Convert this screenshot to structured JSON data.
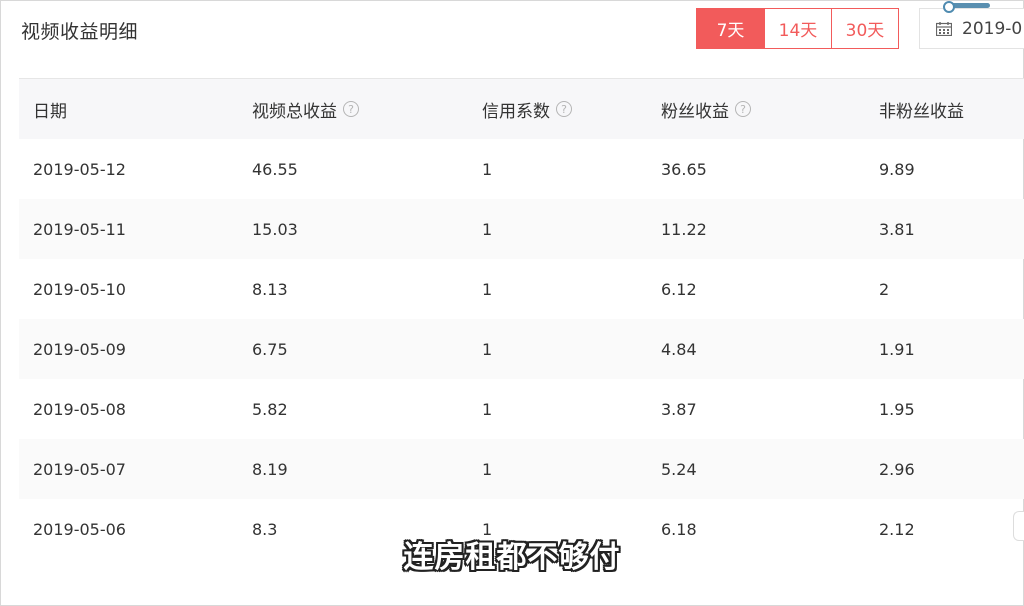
{
  "page": {
    "title": "视频收益明细"
  },
  "range_buttons": [
    {
      "label": "7天",
      "active": true
    },
    {
      "label": "14天",
      "active": false
    },
    {
      "label": "30天",
      "active": false
    }
  ],
  "date_picker": {
    "value": "2019-0",
    "icon": "calendar-icon"
  },
  "colors": {
    "accent": "#f25b5b",
    "header_bg": "#f7f7f9"
  },
  "table": {
    "headers": [
      "日期",
      "视频总收益",
      "信用系数",
      "粉丝收益",
      "非粉丝收益"
    ],
    "help_icon_on": [
      1,
      2,
      3
    ],
    "rows": [
      [
        "2019-05-12",
        "46.55",
        "1",
        "36.65",
        "9.89"
      ],
      [
        "2019-05-11",
        "15.03",
        "1",
        "11.22",
        "3.81"
      ],
      [
        "2019-05-10",
        "8.13",
        "1",
        "6.12",
        "2"
      ],
      [
        "2019-05-09",
        "6.75",
        "1",
        "4.84",
        "1.91"
      ],
      [
        "2019-05-08",
        "5.82",
        "1",
        "3.87",
        "1.95"
      ],
      [
        "2019-05-07",
        "8.19",
        "1",
        "5.24",
        "2.96"
      ],
      [
        "2019-05-06",
        "8.3",
        "1",
        "6.18",
        "2.12"
      ]
    ]
  },
  "caption": "连房租都不够付"
}
